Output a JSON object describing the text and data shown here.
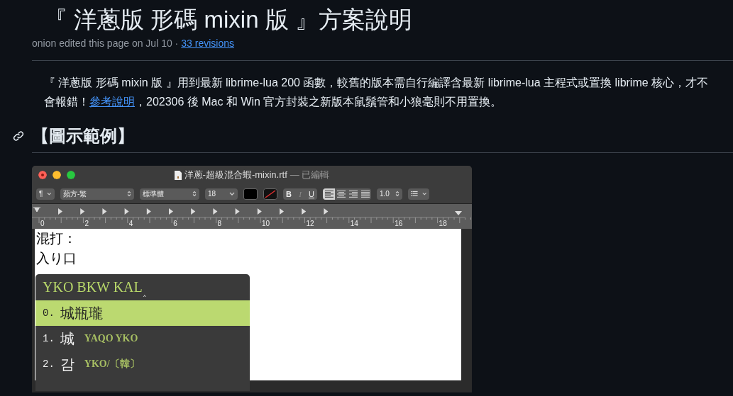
{
  "page": {
    "title": "『 洋蔥版 形碼 mixin 版 』方案說明",
    "meta": "onion edited this page on Jul 10 ·",
    "revisions_link": "33 revisions"
  },
  "intro": {
    "before": "『 洋蔥版 形碼 mixin 版 』用到最新 librime-lua 200 函數，較舊的版本需自行編譯含最新 librime-lua 主程式或置換 librime 核心，才不會報錯！",
    "link": "參考說明",
    "after": "，202306 後 Mac 和 Win 官方封裝之新版本鼠鬚管和小狼毫則不用置換。"
  },
  "section": {
    "heading": "【圖示範例】"
  },
  "screenshot": {
    "window_title": "洋蔥-超級混合蝦-mixin.rtf",
    "title_status": "— 已編輯",
    "toolbar": {
      "paragraph_menu": "¶",
      "font": "蘋方-繁",
      "style": "標準體",
      "size": "18",
      "format_buttons": [
        {
          "kind": "bold",
          "label": "B",
          "disabled": false
        },
        {
          "kind": "italic",
          "label": "I",
          "disabled": true
        },
        {
          "kind": "underline",
          "label": "U",
          "disabled": false
        }
      ],
      "align_buttons": [
        {
          "kind": "left",
          "selected": true
        },
        {
          "kind": "center",
          "selected": false
        },
        {
          "kind": "right",
          "selected": false
        },
        {
          "kind": "justify",
          "selected": false
        }
      ],
      "line_spacing": "1.0"
    },
    "ruler_labels": [
      "0",
      "2",
      "4",
      "6",
      "8",
      "10",
      "12",
      "14",
      "16",
      "18"
    ],
    "document_lines": [
      "混打：",
      "入り口"
    ],
    "candidate_popup": {
      "preedit": "YKO BKW KAL",
      "caret": "‸",
      "candidates": [
        {
          "index": "0.",
          "text": "城瓶瓏",
          "selected": true
        },
        {
          "index": "1.",
          "text": "城",
          "comment": "YAQO YKO",
          "selected": false
        },
        {
          "index": "2.",
          "text": "감",
          "comment": "YKO/〔韓〕",
          "selected": false
        }
      ]
    }
  }
}
